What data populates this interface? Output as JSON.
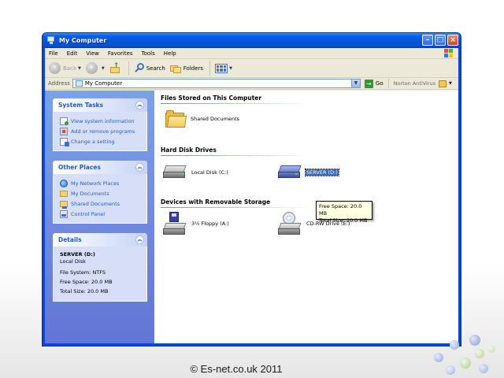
{
  "window": {
    "title": "My Computer",
    "buttons": [
      "minimize-icon",
      "maximize-icon",
      "close-icon"
    ]
  },
  "menu": [
    "File",
    "Edit",
    "View",
    "Favorites",
    "Tools",
    "Help"
  ],
  "toolbar": {
    "back_label": "Back",
    "search_label": "Search",
    "folders_label": "Folders"
  },
  "address": {
    "label": "Address",
    "value": "My Computer",
    "go_label": "Go",
    "norton_label": "Norton AntiVirus"
  },
  "sidebar": {
    "system_tasks": {
      "title": "System Tasks",
      "items": [
        "View system information",
        "Add or remove programs",
        "Change a setting"
      ]
    },
    "other_places": {
      "title": "Other Places",
      "items": [
        "My Network Places",
        "My Documents",
        "Shared Documents",
        "Control Panel"
      ]
    },
    "details": {
      "title": "Details",
      "name": "SERVER (D:)",
      "type": "Local Disk",
      "file_system": "File System: NTFS",
      "free_space": "Free Space: 20.0 MB",
      "total_size": "Total Size: 20.0 MB"
    }
  },
  "groups": {
    "files_stored": {
      "title": "Files Stored on This Computer",
      "items": [
        "Shared Documents"
      ]
    },
    "hard_disks": {
      "title": "Hard Disk Drives",
      "items": [
        "Local Disk (C:)",
        "SERVER (D:)"
      ]
    },
    "removable": {
      "title": "Devices with Removable Storage",
      "items": [
        "3½ Floppy (A:)",
        "CD-RW Drive (E:)"
      ]
    }
  },
  "tooltip": {
    "free_space": "Free Space: 20.0 MB",
    "total_size": "Total Size: 20.0 MB"
  },
  "footer": {
    "text": "© Es-net.co.uk 2011"
  },
  "colors": {
    "titlebar": "#0653d8",
    "sidebar_gradient_top": "#7ba2e7",
    "sidebar_gradient_bottom": "#6375d6",
    "panel_title": "#215dc6",
    "selection": "#316ac5"
  }
}
